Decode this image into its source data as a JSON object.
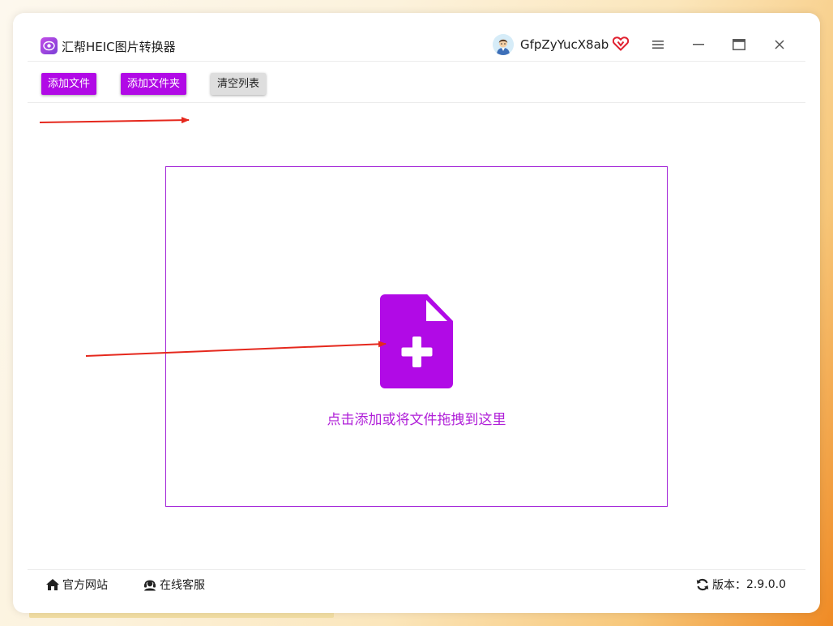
{
  "colors": {
    "accent": "#b10ae6",
    "drop_border": "#a224d8",
    "drop_text": "#b020d8",
    "annotation_arrow": "#e5281d",
    "vip": "#e0202f"
  },
  "titlebar": {
    "app_title": "汇帮HEIC图片转换器",
    "app_icon": "app-logo-icon",
    "avatar_icon": "user-avatar-icon",
    "username": "GfpZyYucX8ab",
    "vip_icon": "vip-heart-icon",
    "controls": [
      "menu-icon",
      "minimize-icon",
      "maximize-icon",
      "close-icon"
    ]
  },
  "toolbar": {
    "add_file_label": "添加文件",
    "add_folder_label": "添加文件夹",
    "clear_list_label": "清空列表"
  },
  "drop_zone": {
    "icon": "add-file-icon",
    "text": "点击添加或将文件拖拽到这里"
  },
  "footer": {
    "website_label": "官方网站",
    "website_icon": "home-icon",
    "support_label": "在线客服",
    "support_icon": "headset-icon",
    "version_icon": "refresh-icon",
    "version_label": "版本：",
    "version_value": "2.9.0.0"
  }
}
